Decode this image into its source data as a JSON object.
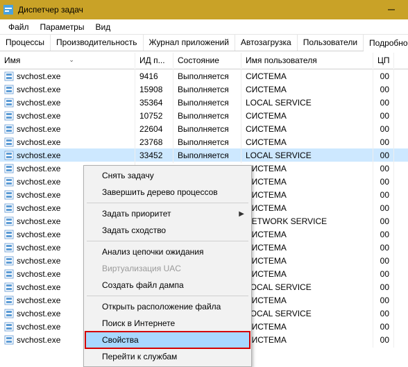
{
  "titlebar": {
    "title": "Диспетчер задач"
  },
  "menu": {
    "file": "Файл",
    "options": "Параметры",
    "view": "Вид"
  },
  "tabs": {
    "processes": "Процессы",
    "performance": "Производительность",
    "apphistory": "Журнал приложений",
    "startup": "Автозагрузка",
    "users": "Пользователи",
    "details": "Подробности"
  },
  "columns": {
    "name": "Имя",
    "pid": "ИД п...",
    "state": "Состояние",
    "user": "Имя пользователя",
    "cpu": "ЦП"
  },
  "rows": [
    {
      "name": "svchost.exe",
      "pid": "9416",
      "state": "Выполняется",
      "user": "СИСТЕМА",
      "cpu": "00"
    },
    {
      "name": "svchost.exe",
      "pid": "15908",
      "state": "Выполняется",
      "user": "СИСТЕМА",
      "cpu": "00"
    },
    {
      "name": "svchost.exe",
      "pid": "35364",
      "state": "Выполняется",
      "user": "LOCAL SERVICE",
      "cpu": "00"
    },
    {
      "name": "svchost.exe",
      "pid": "10752",
      "state": "Выполняется",
      "user": "СИСТЕМА",
      "cpu": "00"
    },
    {
      "name": "svchost.exe",
      "pid": "22604",
      "state": "Выполняется",
      "user": "СИСТЕМА",
      "cpu": "00"
    },
    {
      "name": "svchost.exe",
      "pid": "23768",
      "state": "Выполняется",
      "user": "СИСТЕМА",
      "cpu": "00"
    },
    {
      "name": "svchost.exe",
      "pid": "33452",
      "state": "Выполняется",
      "user": "LOCAL SERVICE",
      "cpu": "00",
      "selected": true
    },
    {
      "name": "svchost.exe",
      "pid": "",
      "state": "",
      "user": "СИСТЕМА",
      "cpu": "00"
    },
    {
      "name": "svchost.exe",
      "pid": "",
      "state": "",
      "user": "СИСТЕМА",
      "cpu": "00"
    },
    {
      "name": "svchost.exe",
      "pid": "",
      "state": "",
      "user": "СИСТЕМА",
      "cpu": "00"
    },
    {
      "name": "svchost.exe",
      "pid": "",
      "state": "",
      "user": "СИСТЕМА",
      "cpu": "00"
    },
    {
      "name": "svchost.exe",
      "pid": "",
      "state": "",
      "user": "NETWORK SERVICE",
      "cpu": "00"
    },
    {
      "name": "svchost.exe",
      "pid": "",
      "state": "",
      "user": "СИСТЕМА",
      "cpu": "00"
    },
    {
      "name": "svchost.exe",
      "pid": "",
      "state": "",
      "user": "СИСТЕМА",
      "cpu": "00"
    },
    {
      "name": "svchost.exe",
      "pid": "",
      "state": "",
      "user": "СИСТЕМА",
      "cpu": "00"
    },
    {
      "name": "svchost.exe",
      "pid": "",
      "state": "",
      "user": "СИСТЕМА",
      "cpu": "00"
    },
    {
      "name": "svchost.exe",
      "pid": "",
      "state": "",
      "user": "LOCAL SERVICE",
      "cpu": "00"
    },
    {
      "name": "svchost.exe",
      "pid": "",
      "state": "",
      "user": "СИСТЕМА",
      "cpu": "00"
    },
    {
      "name": "svchost.exe",
      "pid": "",
      "state": "",
      "user": "LOCAL SERVICE",
      "cpu": "00"
    },
    {
      "name": "svchost.exe",
      "pid": "",
      "state": "",
      "user": "СИСТЕМА",
      "cpu": "00"
    },
    {
      "name": "svchost.exe",
      "pid": "",
      "state": "",
      "user": "СИСТЕМА",
      "cpu": "00"
    }
  ],
  "context_menu": {
    "end_task": "Снять задачу",
    "end_tree": "Завершить дерево процессов",
    "priority": "Задать приоритет",
    "affinity": "Задать сходство",
    "analyze_wait": "Анализ цепочки ожидания",
    "uac_virt": "Виртуализация UAC",
    "create_dump": "Создать файл дампа",
    "open_location": "Открыть расположение файла",
    "search_online": "Поиск в Интернете",
    "properties": "Свойства",
    "goto_services": "Перейти к службам"
  }
}
